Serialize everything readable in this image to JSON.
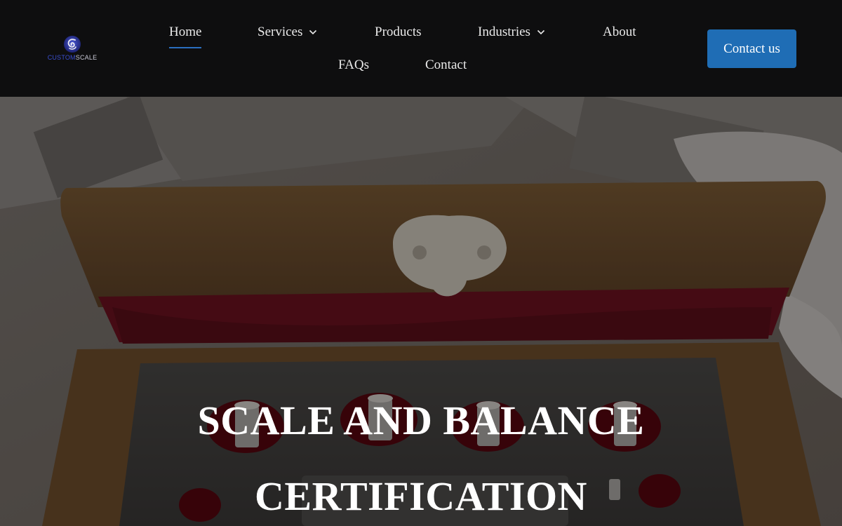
{
  "brand": {
    "logo_text_part1": "CUSTOM",
    "logo_text_part2": "SCALE",
    "logo_icon": "cs-monogram-icon"
  },
  "nav": {
    "items": [
      {
        "label": "Home",
        "active": true
      },
      {
        "label": "Services",
        "has_dropdown": true
      },
      {
        "label": "Products"
      },
      {
        "label": "Industries",
        "has_dropdown": true
      },
      {
        "label": "About"
      },
      {
        "label": "FAQs"
      },
      {
        "label": "Contact"
      }
    ],
    "dropdown_icon": "chevron-down-icon"
  },
  "header": {
    "cta_label": "Contact us"
  },
  "hero": {
    "title_line1": "SCALE AND BALANCE",
    "title_line2": "CERTIFICATION"
  },
  "colors": {
    "header_bg": "#0e0e0f",
    "accent": "#1f6db5",
    "active_underline": "#2b6fbf",
    "nav_text": "#eaeaea"
  }
}
